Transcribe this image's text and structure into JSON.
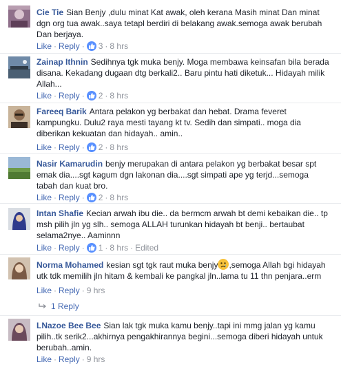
{
  "actions": {
    "like": "Like",
    "reply": "Reply"
  },
  "comments": [
    {
      "author": "Cie Tie",
      "text": "Sian Benjy ,dulu minat Kat awak, oleh kerana Masih minat Dan minat dgn org tua awak..saya tetapl berdiri di belakang awak.semoga awak berubah Dan berjaya.",
      "reactions": "3",
      "time": "8 hrs"
    },
    {
      "author": "Zainap Ithnin",
      "text": "Sedihnya tgk muka benjy. Moga membawa keinsafan bila berada disana. Kekadang dugaan dtg berkali2.. Baru pintu hati diketuk... Hidayah milik Allah...",
      "reactions": "2",
      "time": "8 hrs"
    },
    {
      "author": "Fareeq Barik",
      "text": "Antara pelakon yg berbakat dan hebat. Drama feveret kampungku. Dulu2 raya mesti tayang kt tv. Sedih dan simpati.. moga dia diberikan kekuatan dan hidayah.. amin..",
      "reactions": "2",
      "time": "8 hrs"
    },
    {
      "author": "Nasir Kamarudin",
      "text": "benjy merupakan di antara pelakon yg berbakat besar spt emak dia....sgt kagum dgn lakonan dia....sgt simpati ape yg terjd...semoga tabah dan kuat bro.",
      "reactions": "2",
      "time": "8 hrs"
    },
    {
      "author": "Intan Shafie",
      "text": "Kecian arwah ibu die.. da bermcm arwah bt demi kebaikan die.. tp msh pilih jln yg slh.. semoga ALLAH turunkan hidayah bt benji.. bertaubat selama2nye.. Aaminnn",
      "reactions": "1",
      "time": "8 hrs",
      "edited": "Edited"
    },
    {
      "author": "Norma Mohamed",
      "text_before": "kesian sgt tgk raut muka benjy",
      "text_after": ",semoga Allah bgi hidayah utk tdk memilih jln hitam & kembali ke pangkal jln..lama tu 11 thn penjara..erm",
      "emoji": "sad-face",
      "time": "9 hrs",
      "replies_label": "1 Reply"
    },
    {
      "author": "LNazoe Bee Bee",
      "text": "Sian lak tgk muka kamu benjy..tapi ini mmg jalan yg kamu pilih..tk serik2...akhirnya pengakhirannya begini...semoga diberi hidayah untuk berubah..amin.",
      "time": "9 hrs"
    }
  ],
  "colors": {
    "name": "#365899",
    "link": "#4267b2",
    "meta": "#90949c",
    "text": "#1d2129",
    "like_badge": "#5890ff"
  }
}
